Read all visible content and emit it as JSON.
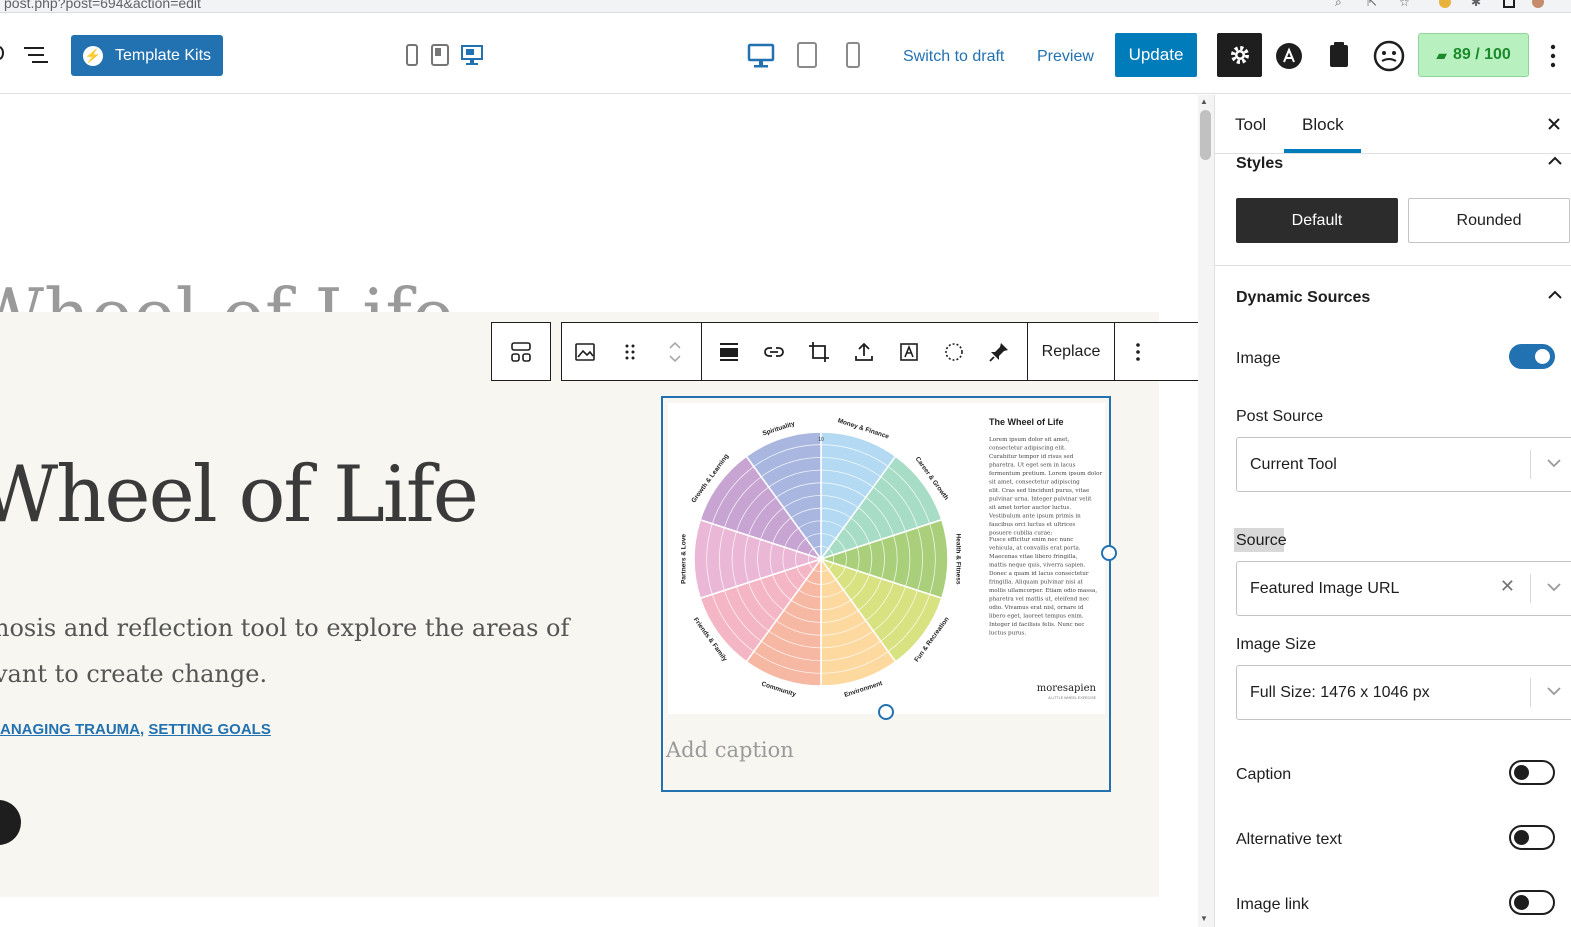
{
  "browser": {
    "url": "post.php?post=694&action=edit"
  },
  "toolbar": {
    "template_kits_label": "Template Kits",
    "template_kits_icon": "elementor-icon",
    "switch_to_draft_label": "Switch to draft",
    "preview_label": "Preview",
    "update_label": "Update",
    "score_label": "89 / 100",
    "colors": {
      "accent": "#2271b1",
      "update": "#007cba",
      "score_bg": "#b9f0c0",
      "score_text": "#1a8a2b"
    }
  },
  "canvas": {
    "ghost_title": "Wheel of Life",
    "heading": "Wheel of Life",
    "paragraph_line1": "nosis and reflection tool to explore the areas of",
    "paragraph_line2": "vant to create change.",
    "tag_prefix": "ANAGING TRAUMA",
    "tag_separator": ",",
    "tag_second": "SETTING GOALS",
    "replace_label": "Replace",
    "caption_placeholder": "Add caption"
  },
  "figure": {
    "title": "The Wheel of Life",
    "segments": [
      "Money & Finance",
      "Career & Growth",
      "Health & Fitness",
      "Fun & Recreation",
      "Environment",
      "Community",
      "Friends & Family",
      "Partners & Love",
      "Growth & Learning",
      "Spirituality"
    ],
    "segment_colors": [
      "#b3daf2",
      "#a7dcc6",
      "#a9cf7a",
      "#d8e281",
      "#fdd9a0",
      "#f6b8a3",
      "#f4b6c4",
      "#eab8d6",
      "#c7a4d2",
      "#a9b7e0"
    ],
    "center_label": "10",
    "body_text_1": "Lorem ipsum dolor sit amet, consectetur adipiscing elit. Curabitur tempor id risus sed pharetra. Ut eget sem in lacus fermentum pretium. Lorem ipsum dolor sit amet, consectetur adipiscing elit. Cras sed tincidunt purus, vitae pulvinar urna. Integer pulvinar velit sit amet tortor auctor luctus. Vestibulum ante ipsum primis in faucibus orci luctus et ultrices posuere cubilia curae;",
    "body_text_2": "Fusce efficitur enim nec nunc vehicula, at convallis erat porta. Maecenas vitae libero fringilla, mattis neque quis, viverra sapien. Donec a quam id lacus consectetur fringilla. Aliquam pulvinar nisi at mollis ullamcorper. Etiam odio massa, pharetra vel mattis ut, eleifend nec odio. Vivamus erat nisl, ornare id libero eget, laoreet tempus enim. Integer id facilisis felis. Nunc nec luctus purus.",
    "brand": "moresapien",
    "brand_sub": "A LITTLE WHEEL EXERCISE"
  },
  "sidebar": {
    "tabs": [
      "Tool",
      "Block"
    ],
    "active_tab": "Block",
    "styles_title": "Styles",
    "style_default": "Default",
    "style_rounded": "Rounded",
    "dynamic_title": "Dynamic Sources",
    "image_label": "Image",
    "image_on": true,
    "post_source_label": "Post Source",
    "post_source_value": "Current Tool",
    "source_label": "Source",
    "source_value": "Featured Image URL",
    "image_size_label": "Image Size",
    "image_size_value": "Full Size: 1476 x 1046 px",
    "caption_label": "Caption",
    "caption_on": false,
    "alt_label": "Alternative text",
    "alt_on": false,
    "link_label": "Image link",
    "link_on": false
  }
}
